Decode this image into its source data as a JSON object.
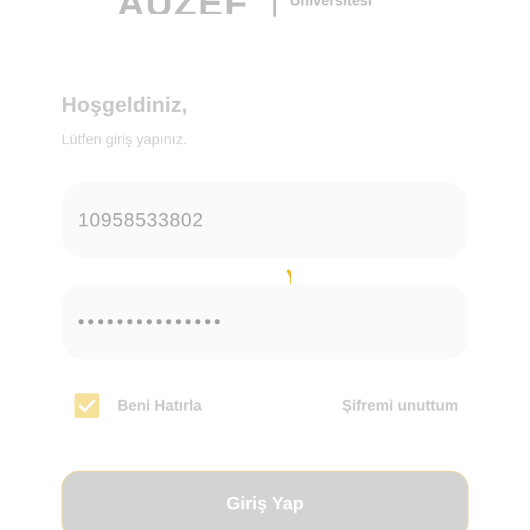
{
  "logo": {
    "mark": "AUZEF",
    "subtitle": "Üniversitesi"
  },
  "welcome": {
    "title": "Hoşgeldiniz,",
    "subtitle": "Lütfen giriş yapınız."
  },
  "form": {
    "username_value": "10958533802",
    "password_value": "•••••••••••••••",
    "remember_label": "Beni Hatırla",
    "remember_checked": true,
    "forgot_label": "Şifremi unuttum",
    "submit_label": "Giriş Yap"
  },
  "loading": {
    "spinner_icon": "loading-spinner-icon",
    "spinner_color": "#f2b824"
  },
  "colors": {
    "accent": "#f2b824",
    "checkbox_fill": "#f6e09a",
    "button_disabled": "#d3d3d3"
  }
}
